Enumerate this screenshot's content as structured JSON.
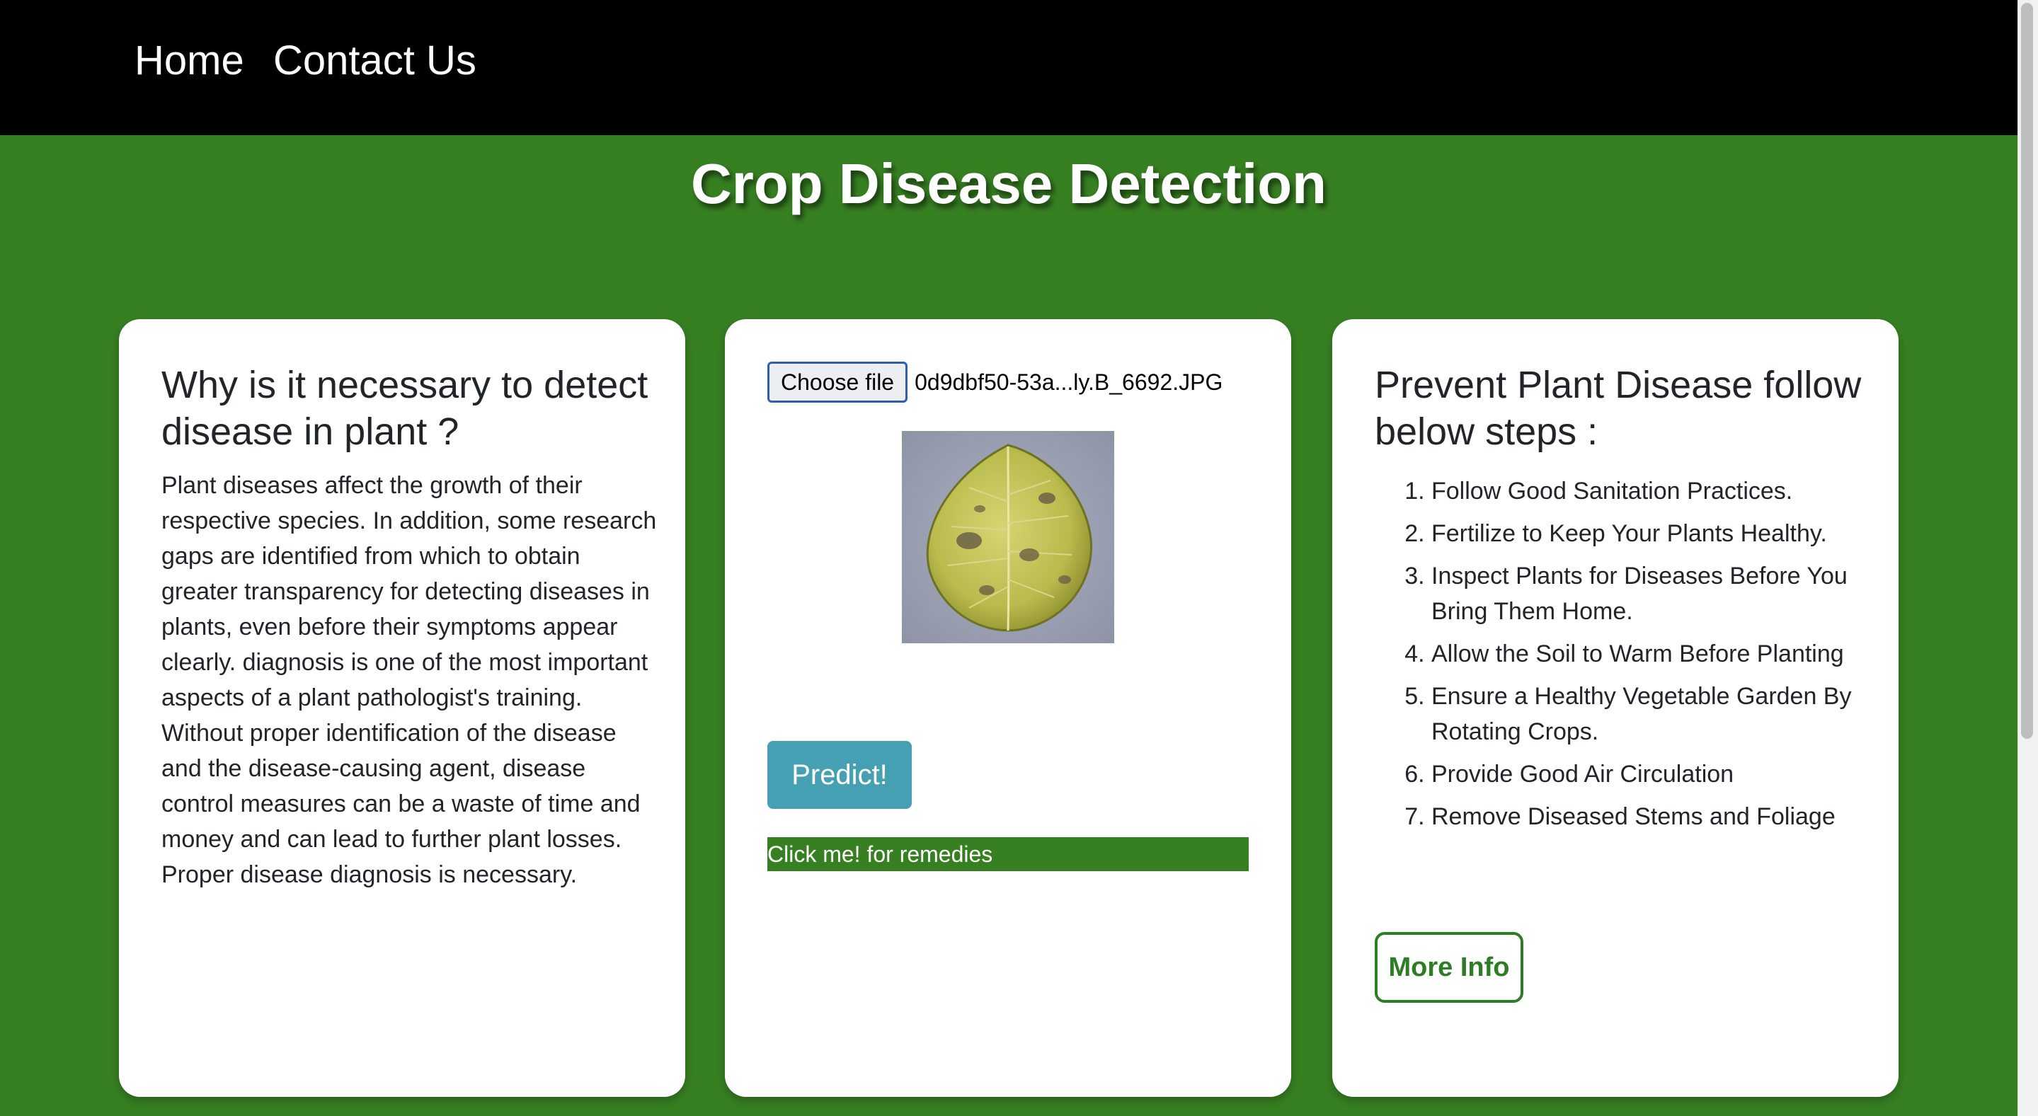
{
  "nav": {
    "home": "Home",
    "contact": "Contact Us"
  },
  "page_title": "Crop Disease Detection",
  "left_card": {
    "title": "Why is it necessary to detect disease in plant ?",
    "body": "Plant diseases affect the growth of their respective species. In addition, some research gaps are identified from which to obtain greater transparency for detecting diseases in plants, even before their symptoms appear clearly. diagnosis is one of the most important aspects of a plant pathologist's training. Without proper identification of the disease and the disease-causing agent, disease control measures can be a waste of time and money and can lead to further plant losses. Proper disease diagnosis is necessary."
  },
  "mid_card": {
    "choose_file_label": "Choose file",
    "file_name": "0d9dbf50-53a...ly.B_6692.JPG",
    "predict_label": "Predict!",
    "remedies_label": "Click me! for remedies"
  },
  "right_card": {
    "title": "Prevent Plant Disease follow below steps :",
    "steps": [
      "Follow Good Sanitation Practices.",
      "Fertilize to Keep Your Plants Healthy.",
      "Inspect Plants for Diseases Before You Bring Them Home.",
      "Allow the Soil to Warm Before Planting",
      "Ensure a Healthy Vegetable Garden By Rotating Crops.",
      "Provide Good Air Circulation",
      "Remove Diseased Stems and Foliage"
    ],
    "more_info_label": "More Info"
  },
  "colors": {
    "background_green": "#378022",
    "nav_black": "#000000",
    "predict_button": "#45a0b4",
    "more_info_green": "#2e7d24"
  }
}
